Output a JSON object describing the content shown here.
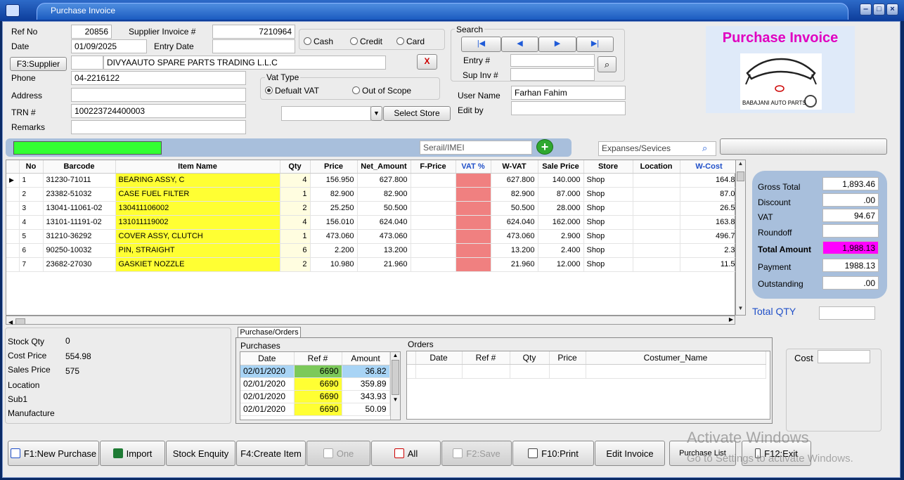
{
  "window": {
    "title": "Purchase Invoice"
  },
  "form": {
    "ref_no_label": "Ref No",
    "ref_no": "20856",
    "date_label": "Date",
    "date": "01/09/2025",
    "supplier_invoice_label": "Supplier Invoice #",
    "supplier_invoice": "7210964",
    "entry_date_label": "Entry Date",
    "entry_date": "",
    "supplier_button": "F3:Supplier",
    "supplier_code": "",
    "supplier_name": "DIVYAAUTO SPARE PARTS TRADING L.L.C",
    "phone_label": "Phone",
    "phone": "04-2216122",
    "address_label": "Address",
    "address": "",
    "trn_label": "TRN #",
    "trn": "100223724400003",
    "remarks_label": "Remarks",
    "remarks": "",
    "clear_button": "X"
  },
  "payment": {
    "cash": "Cash",
    "credit": "Credit",
    "card": "Card"
  },
  "vat_type": {
    "title": "Vat Type",
    "default_vat": "Defualt VAT",
    "out_of_scope": "Out of Scope"
  },
  "store": {
    "selected": "",
    "select_button": "Select Store"
  },
  "search": {
    "title": "Search",
    "entry_label": "Entry #",
    "entry_value": "",
    "sup_inv_label": "Sup Inv #",
    "sup_inv_value": ""
  },
  "user": {
    "user_name_label": "User Name",
    "user_name": "Farhan Fahim",
    "edit_by_label": "Edit by",
    "edit_by": ""
  },
  "logo": {
    "title": "Purchase Invoice",
    "brand": "BABAJANI AUTO PARTS"
  },
  "toolbar": {
    "serial_placeholder": "Serail/IMEI",
    "expenses_placeholder": "Expanses/Sevices"
  },
  "grid": {
    "headers": [
      "No",
      "Barcode",
      "Item Name",
      "Qty",
      "Price",
      "Net_Amount",
      "F-Price",
      "VAT %",
      "W-VAT",
      "Sale Price",
      "Store",
      "Location",
      "W-Cost"
    ],
    "rows": [
      [
        "1",
        "31230-71011",
        "BEARING ASSY, C",
        "4",
        "156.950",
        "627.800",
        "",
        "",
        "627.800",
        "140.000",
        "Shop",
        "",
        "164.8"
      ],
      [
        "2",
        "23382-51032",
        "CASE FUEL FILTER",
        "1",
        "82.900",
        "82.900",
        "",
        "",
        "82.900",
        "87.000",
        "Shop",
        "",
        "87.0"
      ],
      [
        "3",
        "13041-11061-02",
        "130411106002",
        "2",
        "25.250",
        "50.500",
        "",
        "",
        "50.500",
        "28.000",
        "Shop",
        "",
        "26.5"
      ],
      [
        "4",
        "13101-11191-02",
        "131011119002",
        "4",
        "156.010",
        "624.040",
        "",
        "",
        "624.040",
        "162.000",
        "Shop",
        "",
        "163.8"
      ],
      [
        "5",
        "31210-36292",
        "COVER ASSY, CLUTCH",
        "1",
        "473.060",
        "473.060",
        "",
        "",
        "473.060",
        "2.900",
        "Shop",
        "",
        "496.7"
      ],
      [
        "6",
        "90250-10032",
        "PIN, STRAIGHT",
        "6",
        "2.200",
        "13.200",
        "",
        "",
        "13.200",
        "2.400",
        "Shop",
        "",
        "2.3"
      ],
      [
        "7",
        "23682-27030",
        "GASKIET NOZZLE",
        "2",
        "10.980",
        "21.960",
        "",
        "",
        "21.960",
        "12.000",
        "Shop",
        "",
        "11.5"
      ]
    ]
  },
  "totals": {
    "gross_total_label": "Gross Total",
    "gross_total": "1,893.46",
    "discount_label": "Discount",
    "discount": ".00",
    "vat_label": "VAT",
    "vat": "94.67",
    "roundoff_label": "Roundoff",
    "roundoff": "",
    "total_amount_label": "Total Amount",
    "total_amount": "1,988.13",
    "payment_label": "Payment",
    "payment": "1988.13",
    "outstanding_label": "Outstanding",
    "outstanding": ".00",
    "total_qty_label": "Total QTY",
    "total_qty": ""
  },
  "item_info": {
    "stock_qty_label": "Stock Qty",
    "stock_qty": "0",
    "cost_price_label": "Cost Price",
    "cost_price": "554.98",
    "sales_price_label": "Sales Price",
    "sales_price": "575",
    "location_label": "Location",
    "sub1_label": "Sub1",
    "manufacture_label": "Manufacture"
  },
  "purchases": {
    "tab": "Purchase/Orders",
    "title": "Purchases",
    "headers": [
      "Date",
      "Ref #",
      "Amount"
    ],
    "rows": [
      [
        "02/01/2020",
        "6690",
        "36.82"
      ],
      [
        "02/01/2020",
        "6690",
        "359.89"
      ],
      [
        "02/01/2020",
        "6690",
        "343.93"
      ],
      [
        "02/01/2020",
        "6690",
        "50.09"
      ]
    ]
  },
  "orders": {
    "title": "Orders",
    "headers": [
      "Date",
      "Ref #",
      "Qty",
      "Price",
      "Costumer_Name"
    ]
  },
  "cost": {
    "label": "Cost",
    "value": ""
  },
  "buttons": {
    "new_purchase": "F1:New Purchase",
    "import": "Import",
    "stock_enquiry": "Stock Enquity",
    "create_item": "F4:Create Item",
    "one": "One",
    "all": "All",
    "save": "F2:Save",
    "print": "F10:Print",
    "edit_invoice": "Edit Invoice",
    "purchase_list": "Purchase List",
    "exit": "F12:Exit"
  },
  "watermark": {
    "line1": "Activate Windows",
    "line2": "Go to Settings to activate Windows."
  },
  "colors": {
    "item_highlight": "#ffff33",
    "vat_cell": "#f08080",
    "total_highlight": "#ff00ff",
    "logo_title": "#e000c0",
    "progress": "#33ff33"
  }
}
